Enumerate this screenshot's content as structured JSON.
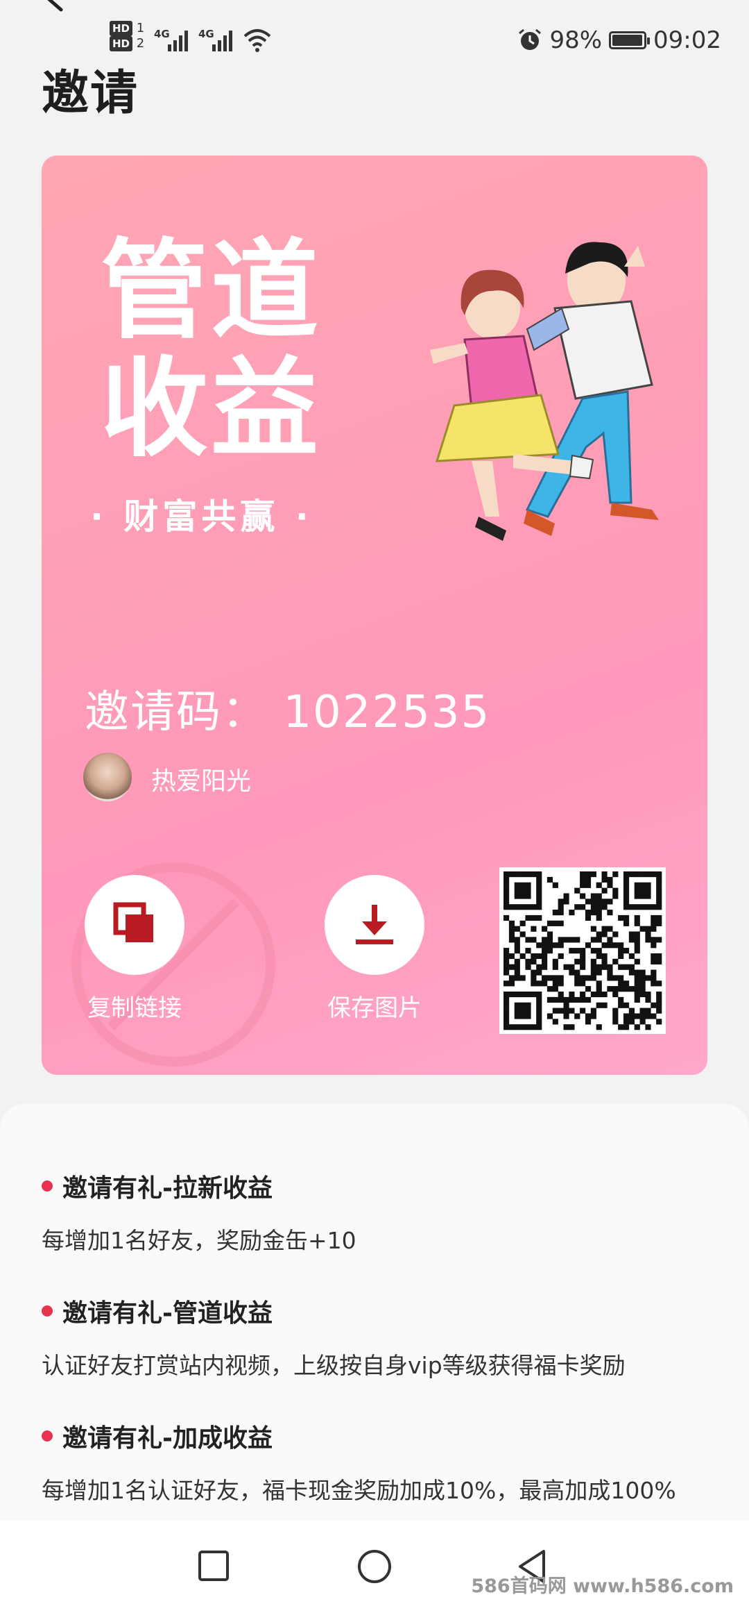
{
  "status_bar": {
    "sim1": "HD",
    "sim1_slot": "1",
    "sim2": "HD",
    "sim2_slot": "2",
    "network1": "4G",
    "network2": "4G",
    "battery_pct": "98%",
    "battery_level": 0.98,
    "time": "09:02",
    "icons": [
      "back-icon",
      "signal-icon",
      "wifi-icon",
      "alarm-icon",
      "battery-icon"
    ]
  },
  "header": {
    "title": "邀请"
  },
  "poster": {
    "title_line1": "管道",
    "title_line2": "收益",
    "subtitle": "· 财富共赢 ·",
    "invite_code": "邀请码： 1022535",
    "username": "热爱阳光",
    "actions": [
      {
        "label": "复制链接",
        "icon": "copy-icon"
      },
      {
        "label": "保存图片",
        "icon": "download-icon"
      }
    ],
    "colors": {
      "bg_start": "#ffa6b4",
      "bg_end": "#ffa8cc",
      "icon_red": "#b81c22"
    }
  },
  "benefits": [
    {
      "title": "邀请有礼-拉新收益",
      "desc": "每增加1名好友，奖励金缶+10"
    },
    {
      "title": "邀请有礼-管道收益",
      "desc": "认证好友打赏站内视频，上级按自身vip等级获得福卡奖励"
    },
    {
      "title": "邀请有礼-加成收益",
      "desc": "每增加1名认证好友，福卡现金奖励加成10%，最高加成100%"
    }
  ],
  "navbar": {
    "icons": [
      "recent-apps-icon",
      "home-icon",
      "back-nav-icon"
    ]
  },
  "watermark": "586首码网 www.h586.com"
}
